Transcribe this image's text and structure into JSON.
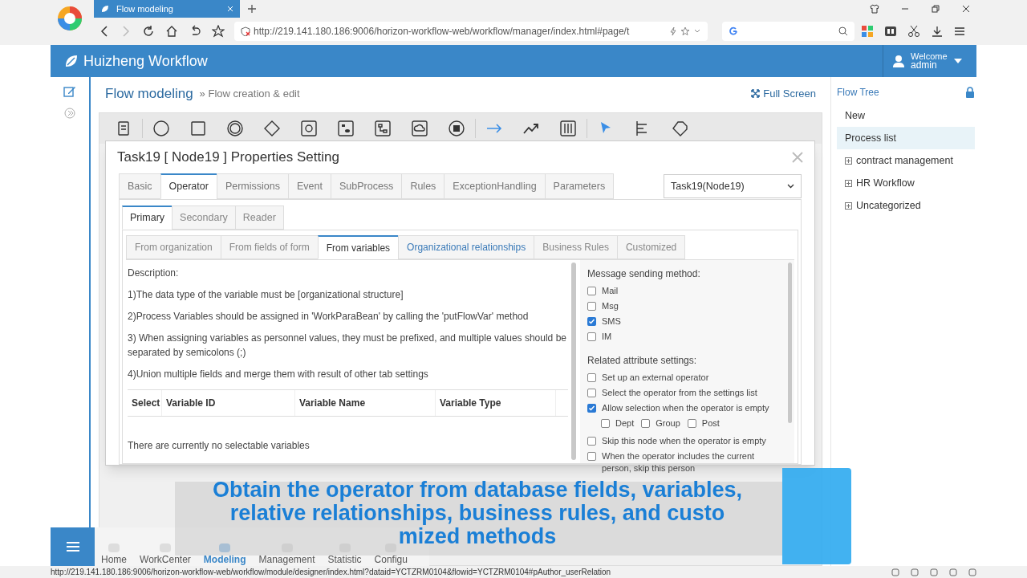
{
  "browser": {
    "tab_title": "Flow modeling",
    "url": "http://219.141.180.186:9006/horizon-workflow-web/workflow/manager/index.html#page/t",
    "status_url": "http://219.141.180.186:9006/horizon-workflow-web/workflow/module/designer/index.html?dataid=YCTZRM0104&flowid=YCTZRM0104#pAuthor_userRelation"
  },
  "app": {
    "title": "Huizheng Workflow",
    "user": {
      "greeting": "Welcome",
      "name": "admin"
    }
  },
  "page": {
    "title": "Flow modeling",
    "breadcrumb": "» Flow creation & edit",
    "fullscreen": "Full Screen"
  },
  "flow_tree": {
    "title": "Flow Tree",
    "items": [
      {
        "label": "New",
        "selected": false,
        "expandable": false
      },
      {
        "label": "Process list",
        "selected": true,
        "expandable": false
      },
      {
        "label": "contract management",
        "selected": false,
        "expandable": true
      },
      {
        "label": "HR Workflow",
        "selected": false,
        "expandable": true
      },
      {
        "label": "Uncategorized",
        "selected": false,
        "expandable": true
      }
    ]
  },
  "dialog": {
    "title": "Task19 [ Node19 ] Properties Setting",
    "tabs": [
      {
        "label": "Basic",
        "selected": false
      },
      {
        "label": "Operator",
        "selected": true
      },
      {
        "label": "Permissions",
        "selected": false
      },
      {
        "label": "Event",
        "selected": false
      },
      {
        "label": "SubProcess",
        "selected": false
      },
      {
        "label": "Rules",
        "selected": false
      },
      {
        "label": "ExceptionHandling",
        "selected": false
      },
      {
        "label": "Parameters",
        "selected": false
      }
    ],
    "node_select": "Task19(Node19)",
    "subtabs": [
      {
        "label": "Primary",
        "selected": true
      },
      {
        "label": "Secondary",
        "selected": false
      },
      {
        "label": "Reader",
        "selected": false
      }
    ],
    "source_tabs": [
      {
        "label": "From organization",
        "selected": false
      },
      {
        "label": "From fields of form",
        "selected": false
      },
      {
        "label": "From variables",
        "selected": true
      },
      {
        "label": "Organizational relationships",
        "selected": false
      },
      {
        "label": "Business Rules",
        "selected": false
      },
      {
        "label": "Customized",
        "selected": false
      }
    ],
    "description": [
      "Description:",
      "1)The data type of the variable must be [organizational structure]",
      "2)Process Variables should be assigned in 'WorkParaBean' by calling the 'putFlowVar' method",
      "3) When assigning variables as personnel values, they must be prefixed, and multiple values should be separated by semicolons (;)",
      "4)Union multiple fields and merge them with result of other tab settings"
    ],
    "table": {
      "columns": [
        "Select",
        "Variable ID",
        "Variable Name",
        "Variable Type"
      ],
      "empty_text": "There are currently no selectable variables"
    },
    "message_method": {
      "title": "Message sending method:",
      "options": [
        {
          "label": "Mail",
          "checked": false
        },
        {
          "label": "Msg",
          "checked": false
        },
        {
          "label": "SMS",
          "checked": true
        },
        {
          "label": "IM",
          "checked": false
        }
      ]
    },
    "related": {
      "title": "Related attribute settings:",
      "options": [
        {
          "label": "Set up an external operator",
          "checked": false
        },
        {
          "label": "Select the operator from the settings list",
          "checked": false
        },
        {
          "label": "Allow selection when the operator is empty",
          "checked": true,
          "children": [
            {
              "label": "Dept",
              "checked": false
            },
            {
              "label": "Group",
              "checked": false
            },
            {
              "label": "Post",
              "checked": false
            }
          ]
        },
        {
          "label": "Skip this node when the operator is empty",
          "checked": false
        },
        {
          "label": "When the operator includes the current person, skip this person",
          "checked": false
        }
      ]
    }
  },
  "bottom_nav": [
    {
      "label": "Home",
      "selected": false
    },
    {
      "label": "WorkCenter",
      "selected": false
    },
    {
      "label": "Modeling",
      "selected": true
    },
    {
      "label": "Management",
      "selected": false
    },
    {
      "label": "Statistic",
      "selected": false
    },
    {
      "label": "Configu",
      "selected": false
    }
  ],
  "caption": [
    "Obtain the operator from database fields, variables,",
    "relative relationships, business rules, and custo",
    "mized methods"
  ]
}
